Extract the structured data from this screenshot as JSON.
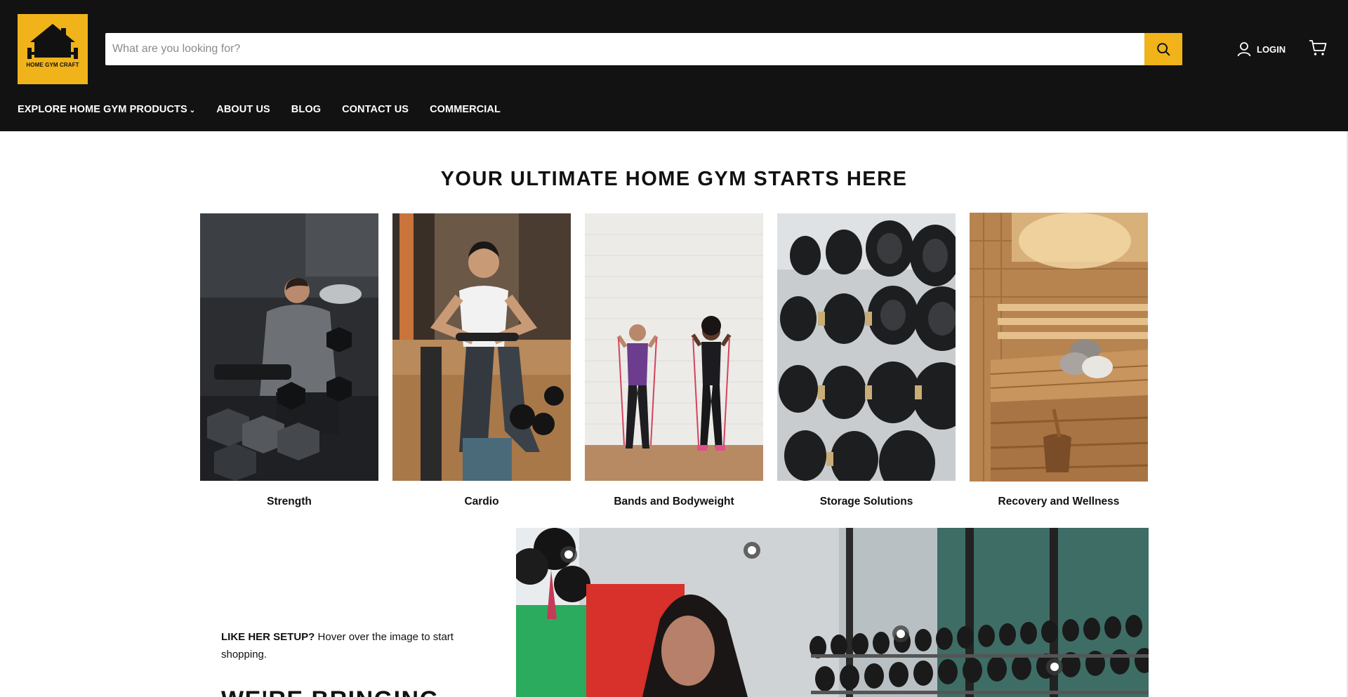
{
  "brand": {
    "logo_text": "HOME GYM CRAFT",
    "accent": "#f0b31a",
    "header_bg": "#121212"
  },
  "search": {
    "placeholder": "What are you looking for?",
    "value": ""
  },
  "header": {
    "login_label": "LOGIN",
    "cart_icon": "cart-icon",
    "search_icon": "search-icon",
    "user_icon": "user-icon"
  },
  "nav": {
    "items": [
      {
        "label": "EXPLORE HOME GYM PRODUCTS",
        "has_dropdown": true
      },
      {
        "label": "ABOUT US"
      },
      {
        "label": "BLOG"
      },
      {
        "label": "CONTACT US"
      },
      {
        "label": "COMMERCIAL"
      }
    ]
  },
  "hero": {
    "title": "YOUR ULTIMATE HOME GYM STARTS HERE"
  },
  "categories": [
    {
      "label": "Strength"
    },
    {
      "label": "Cardio"
    },
    {
      "label": "Bands and Bodyweight"
    },
    {
      "label": "Storage Solutions"
    },
    {
      "label": "Recovery and Wellness"
    }
  ],
  "shop_the_look": {
    "lead_bold": "LIKE HER SETUP?",
    "lead_text": " Hover over the image to start shopping.",
    "heading_partial": "WE'RE BRINGING"
  }
}
